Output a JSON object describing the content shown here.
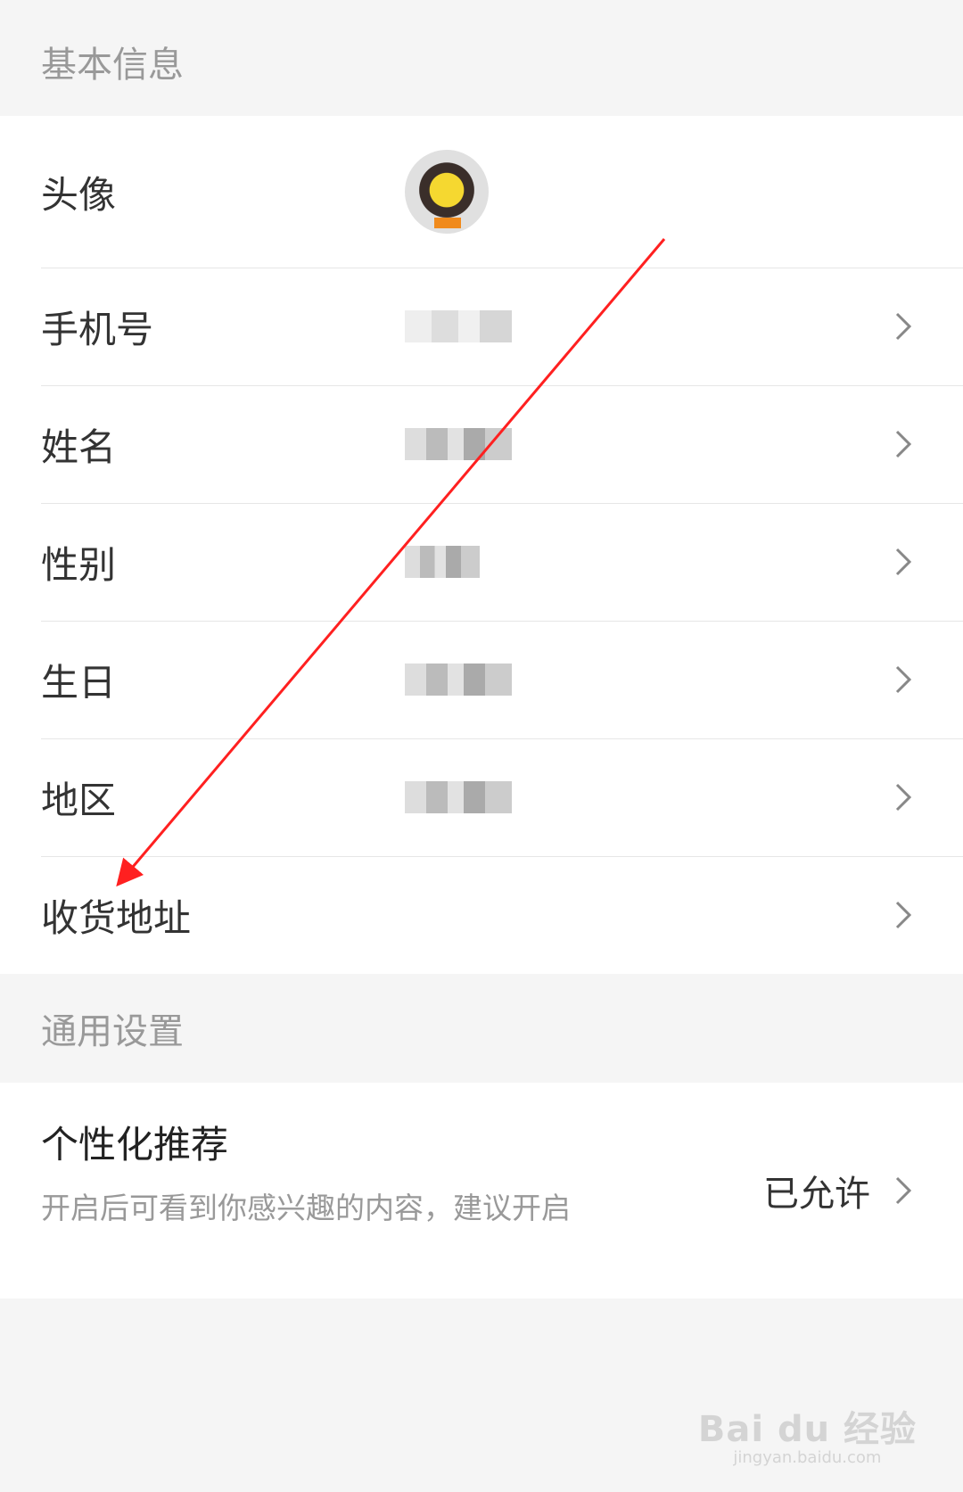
{
  "basic_section": {
    "header": "基本信息"
  },
  "rows": [
    {
      "label": "头像"
    },
    {
      "label": "手机号"
    },
    {
      "label": "姓名"
    },
    {
      "label": "性别"
    },
    {
      "label": "生日"
    },
    {
      "label": "地区"
    },
    {
      "label": "收货地址"
    }
  ],
  "general_section": {
    "header": "通用设置",
    "recommend": {
      "title": "个性化推荐",
      "description": "开启后可看到你感兴趣的内容，建议开启",
      "status": "已允许"
    }
  },
  "watermark": {
    "brand": "Bai du 经验",
    "url": "jingyan.baidu.com"
  },
  "colors": {
    "annotation_arrow": "#ff2020",
    "header_bg": "#f5f5f5",
    "row_bg": "#ffffff"
  },
  "icons": {
    "row_arrow": "chevron-right-icon"
  }
}
